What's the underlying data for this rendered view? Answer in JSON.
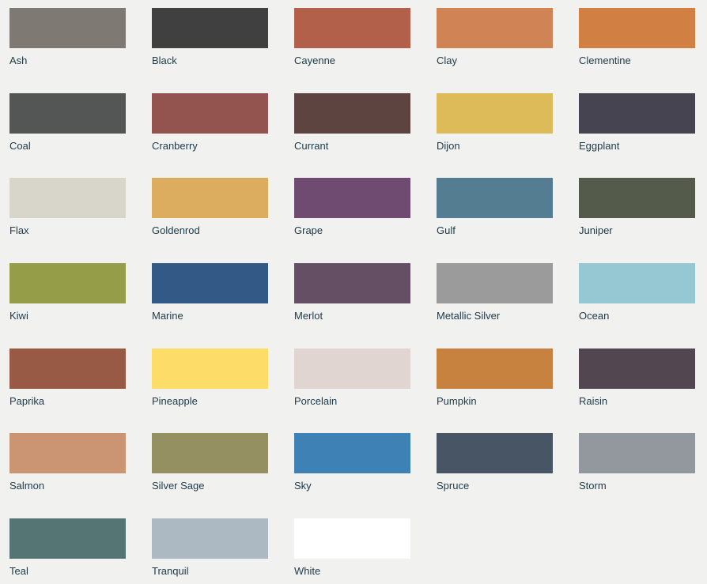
{
  "swatches": [
    {
      "name": "Ash",
      "color": "#7e7972"
    },
    {
      "name": "Black",
      "color": "#404040"
    },
    {
      "name": "Cayenne",
      "color": "#b3604a"
    },
    {
      "name": "Clay",
      "color": "#d08354"
    },
    {
      "name": "Clementine",
      "color": "#d27f44"
    },
    {
      "name": "Coal",
      "color": "#545555"
    },
    {
      "name": "Cranberry",
      "color": "#93544f"
    },
    {
      "name": "Currant",
      "color": "#5e4440"
    },
    {
      "name": "Dijon",
      "color": "#dcbb58"
    },
    {
      "name": "Eggplant",
      "color": "#464450"
    },
    {
      "name": "Flax",
      "color": "#d8d6ca"
    },
    {
      "name": "Goldenrod",
      "color": "#dcad5e"
    },
    {
      "name": "Grape",
      "color": "#6f4b72"
    },
    {
      "name": "Gulf",
      "color": "#557d91"
    },
    {
      "name": "Juniper",
      "color": "#555b4b"
    },
    {
      "name": "Kiwi",
      "color": "#969d48"
    },
    {
      "name": "Marine",
      "color": "#335987"
    },
    {
      "name": "Merlot",
      "color": "#654f64"
    },
    {
      "name": "Metallic Silver",
      "color": "#9b9b9b"
    },
    {
      "name": "Ocean",
      "color": "#96c8d3"
    },
    {
      "name": "Paprika",
      "color": "#995a45"
    },
    {
      "name": "Pineapple",
      "color": "#fddd68"
    },
    {
      "name": "Porcelain",
      "color": "#e0d5d0"
    },
    {
      "name": "Pumpkin",
      "color": "#c8823f"
    },
    {
      "name": "Raisin",
      "color": "#524651"
    },
    {
      "name": "Salmon",
      "color": "#cb9573"
    },
    {
      "name": "Silver Sage",
      "color": "#949062"
    },
    {
      "name": "Sky",
      "color": "#3e82b5"
    },
    {
      "name": "Spruce",
      "color": "#475564"
    },
    {
      "name": "Storm",
      "color": "#93989e"
    },
    {
      "name": "Teal",
      "color": "#557474"
    },
    {
      "name": "Tranquil",
      "color": "#adb9c2"
    },
    {
      "name": "White",
      "color": "#ffffff"
    }
  ]
}
